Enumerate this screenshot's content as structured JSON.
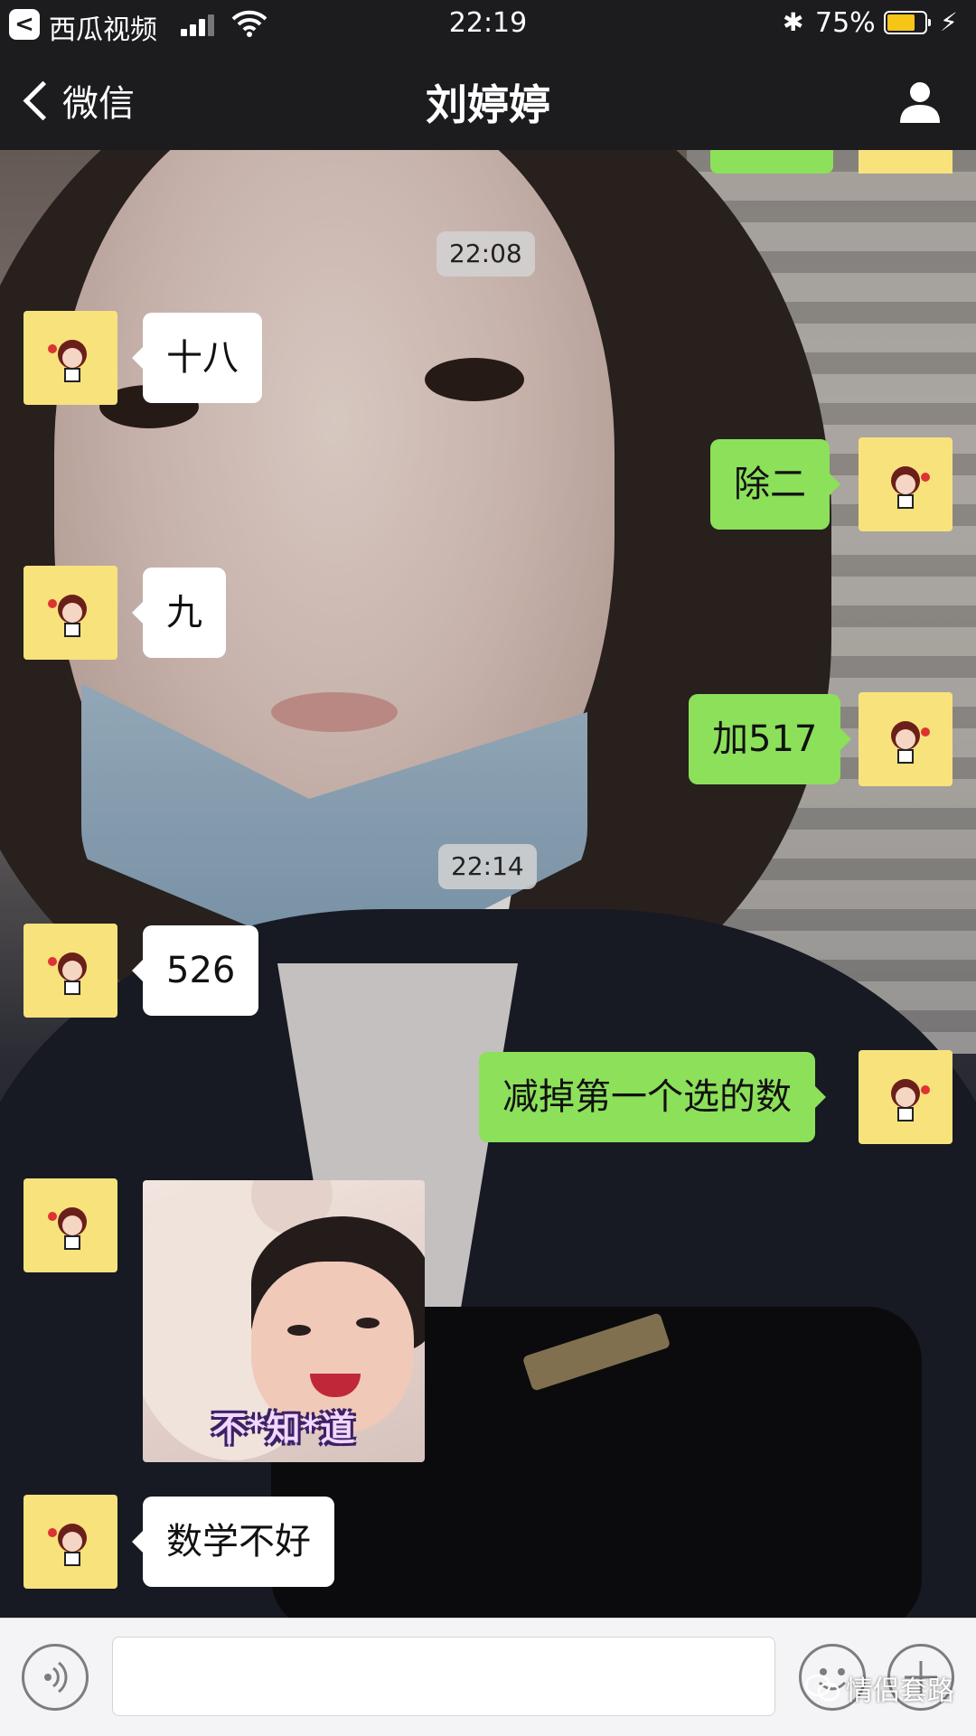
{
  "status_bar": {
    "back_app": "西瓜视频",
    "time": "22:19",
    "battery_percent": "75%",
    "battery_level": 0.75,
    "icons": [
      "back-to-app-icon",
      "signal-icon",
      "wifi-icon",
      "bluetooth-icon",
      "battery-icon",
      "charging-icon"
    ]
  },
  "nav": {
    "back_label": "微信",
    "title": "刘婷婷",
    "profile_icon": "person-icon"
  },
  "colors": {
    "incoming_bubble": "#ffffff",
    "outgoing_bubble": "#8ce05a",
    "avatar_bg": "#f8e27c",
    "bar_bg": "#1c1b1e"
  },
  "messages": {
    "ts1": "22:08",
    "m1": "十八",
    "m2": "除二",
    "m3": "九",
    "m4": "加517",
    "ts2": "22:14",
    "m5": "526",
    "m6": "减掉第一个选的数",
    "sticker_caption": "不*知*道",
    "m7": "数学不好"
  },
  "input_bar": {
    "icons": [
      "voice-icon",
      "emoji-icon",
      "plus-icon"
    ]
  },
  "watermark": "情侣套路"
}
